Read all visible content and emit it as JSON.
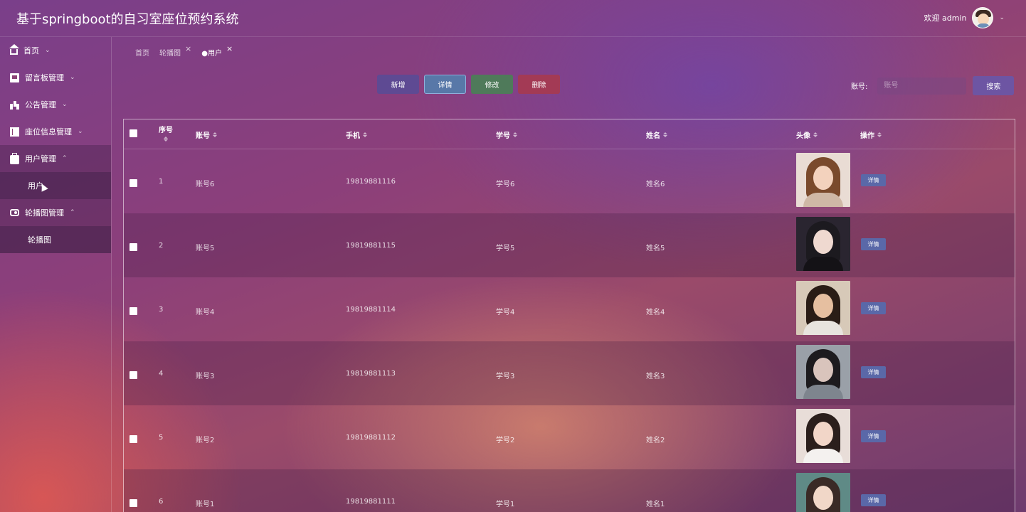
{
  "header": {
    "title": "基于springboot的自习室座位预约系统",
    "welcome": "欢迎 admin",
    "dropdown_icon": "chevron-down-icon"
  },
  "sidebar": {
    "items": [
      {
        "label": "首页",
        "icon": "home-icon",
        "chevron": "⌄"
      },
      {
        "label": "留言板管理",
        "icon": "message-board-icon",
        "chevron": "⌄"
      },
      {
        "label": "公告管理",
        "icon": "announcement-icon",
        "chevron": "⌄"
      },
      {
        "label": "座位信息管理",
        "icon": "seat-info-icon",
        "chevron": "⌄"
      },
      {
        "label": "用户管理",
        "icon": "user-management-icon",
        "chevron": "⌃",
        "sub": "用户"
      },
      {
        "label": "轮播图管理",
        "icon": "carousel-icon",
        "chevron": "⌃",
        "sub": "轮播图"
      }
    ]
  },
  "tabs": [
    {
      "label": "首页",
      "closable": false
    },
    {
      "label": "轮播图",
      "closable": true
    },
    {
      "label": "●用户",
      "closable": true,
      "active": true
    }
  ],
  "tab_close": "×",
  "toolbar": {
    "add": "新增",
    "detail": "详情",
    "edit": "修改",
    "delete": "删除"
  },
  "search": {
    "label": "账号:",
    "placeholder": "账号",
    "button": "搜索"
  },
  "table": {
    "columns": [
      "序号",
      "账号",
      "手机",
      "学号",
      "姓名",
      "头像",
      "操作"
    ],
    "row_action": "详情",
    "rows": [
      {
        "seq": "1",
        "account": "账号6",
        "phone": "19819881116",
        "student_id": "学号6",
        "name": "姓名6"
      },
      {
        "seq": "2",
        "account": "账号5",
        "phone": "19819881115",
        "student_id": "学号5",
        "name": "姓名5"
      },
      {
        "seq": "3",
        "account": "账号4",
        "phone": "19819881114",
        "student_id": "学号4",
        "name": "姓名4"
      },
      {
        "seq": "4",
        "account": "账号3",
        "phone": "19819881113",
        "student_id": "学号3",
        "name": "姓名3"
      },
      {
        "seq": "5",
        "account": "账号2",
        "phone": "19819881112",
        "student_id": "学号2",
        "name": "姓名2"
      },
      {
        "seq": "6",
        "account": "账号1",
        "phone": "19819881111",
        "student_id": "学号1",
        "name": "姓名1"
      }
    ]
  },
  "colors": {
    "add_button": "#5e4a93",
    "detail_button": "#5878a8",
    "edit_button": "#4f7a5a",
    "delete_button": "#a33a55",
    "search_button": "#6d55a3"
  }
}
